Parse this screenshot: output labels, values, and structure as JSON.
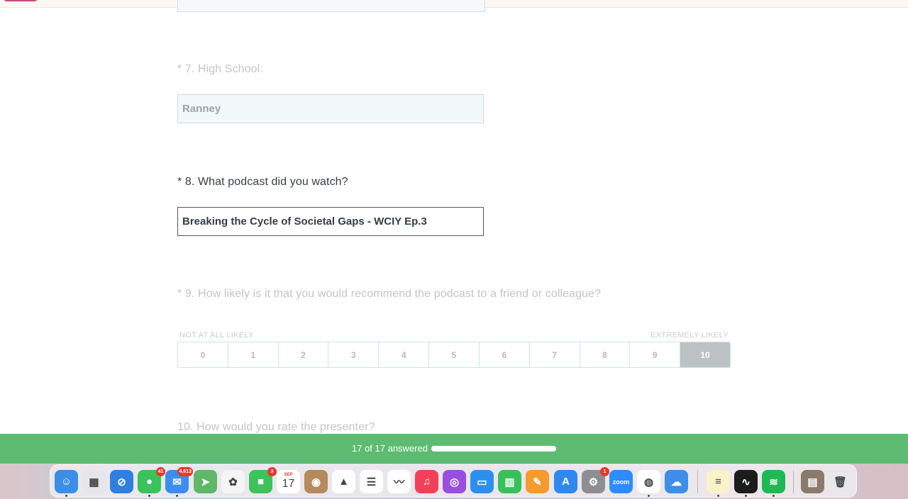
{
  "questions": {
    "q7": {
      "label": "* 7. High School:",
      "value": "Ranney"
    },
    "q8": {
      "label": "* 8. What podcast did you watch?",
      "value": "Breaking the Cycle of Societal Gaps - WCIY Ep.3"
    },
    "q9": {
      "label": "* 9. How likely is it that you would recommend the podcast to a friend or colleague?",
      "low_label": "NOT AT ALL LIKELY",
      "high_label": "EXTREMELY LIKELY",
      "options": [
        "0",
        "1",
        "2",
        "3",
        "4",
        "5",
        "6",
        "7",
        "8",
        "9",
        "10"
      ],
      "selected": "10"
    },
    "q10": {
      "label": "10. How would you rate the presenter?"
    }
  },
  "progress": {
    "label": "17 of 17 answered",
    "fraction": 1.0
  },
  "dock": {
    "apps": [
      {
        "name": "finder-icon",
        "color": "#3a8ee6",
        "glyph": "☺",
        "running": true
      },
      {
        "name": "launchpad-icon",
        "color": "#e6e6ea",
        "glyph": "▦"
      },
      {
        "name": "safari-icon",
        "color": "#2f7fe0",
        "glyph": "⊘"
      },
      {
        "name": "messages-icon",
        "color": "#39c35a",
        "glyph": "●",
        "badge": "41",
        "running": true
      },
      {
        "name": "mail-icon",
        "color": "#3b8ef0",
        "glyph": "✉",
        "badge": "4,613",
        "running": true
      },
      {
        "name": "maps-icon",
        "color": "#5fb86a",
        "glyph": "➤"
      },
      {
        "name": "photos-icon",
        "color": "#f5f5f5",
        "glyph": "✿"
      },
      {
        "name": "facetime-icon",
        "color": "#3cc35a",
        "glyph": "■",
        "badge": "3"
      },
      {
        "name": "calendar-icon",
        "color": "#ffffff",
        "glyph": "17",
        "month": "SEP"
      },
      {
        "name": "contacts-icon",
        "color": "#b68a5a",
        "glyph": "◉"
      },
      {
        "name": "google-drive-icon",
        "color": "#ffffff",
        "glyph": "▲"
      },
      {
        "name": "reminders-icon",
        "color": "#ffffff",
        "glyph": "☰"
      },
      {
        "name": "freeform-icon",
        "color": "#ffffff",
        "glyph": "〰"
      },
      {
        "name": "music-icon",
        "color": "#f3405a",
        "glyph": "♫"
      },
      {
        "name": "podcasts-icon",
        "color": "#9a4ee0",
        "glyph": "◎"
      },
      {
        "name": "keynote-icon",
        "color": "#2e8ef0",
        "glyph": "▭"
      },
      {
        "name": "numbers-icon",
        "color": "#38c05a",
        "glyph": "▥"
      },
      {
        "name": "pages-icon",
        "color": "#f59a2c",
        "glyph": "✎"
      },
      {
        "name": "app-store-icon",
        "color": "#2f88f0",
        "glyph": "A"
      },
      {
        "name": "system-settings-icon",
        "color": "#8d8d92",
        "glyph": "⚙",
        "badge": "1"
      },
      {
        "name": "zoom-icon",
        "color": "#2d8cff",
        "glyph": "zoom"
      },
      {
        "name": "chrome-icon",
        "color": "#ffffff",
        "glyph": "◍",
        "running": true
      },
      {
        "name": "weather-icon",
        "color": "#3c8ee8",
        "glyph": "☁"
      },
      {
        "name": "notes-icon",
        "color": "#fbf3c7",
        "glyph": "≡",
        "running": true
      },
      {
        "name": "activity-monitor-icon",
        "color": "#1c1c1c",
        "glyph": "∿",
        "running": true
      },
      {
        "name": "spotify-icon",
        "color": "#1fb954",
        "glyph": "≋",
        "running": true
      },
      {
        "name": "downloads-stack-icon",
        "color": "#8a7a6a",
        "glyph": "▤"
      },
      {
        "name": "trash-icon",
        "color": "#e8e8ea",
        "glyph": "🗑"
      }
    ]
  }
}
